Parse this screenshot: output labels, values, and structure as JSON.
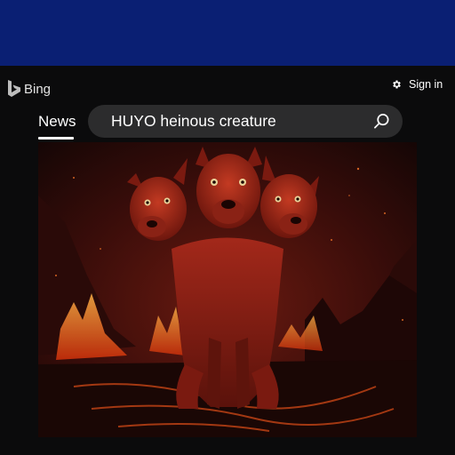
{
  "logo": {
    "text": "Bing",
    "icon": "bing-logo-icon"
  },
  "header": {
    "signin_label": "Sign in",
    "settings_icon": "gear-icon"
  },
  "tabs": [
    {
      "label": "News",
      "active": true
    }
  ],
  "search": {
    "query": "HUYO heinous creature",
    "icon": "search-icon"
  },
  "result_image": {
    "subject": "three-headed red hound in a volcanic landscape"
  },
  "colors": {
    "topbar": "#0a1f73",
    "background": "#0b0b0c",
    "search_bg": "#2c2c2d",
    "text": "#ffffff"
  }
}
